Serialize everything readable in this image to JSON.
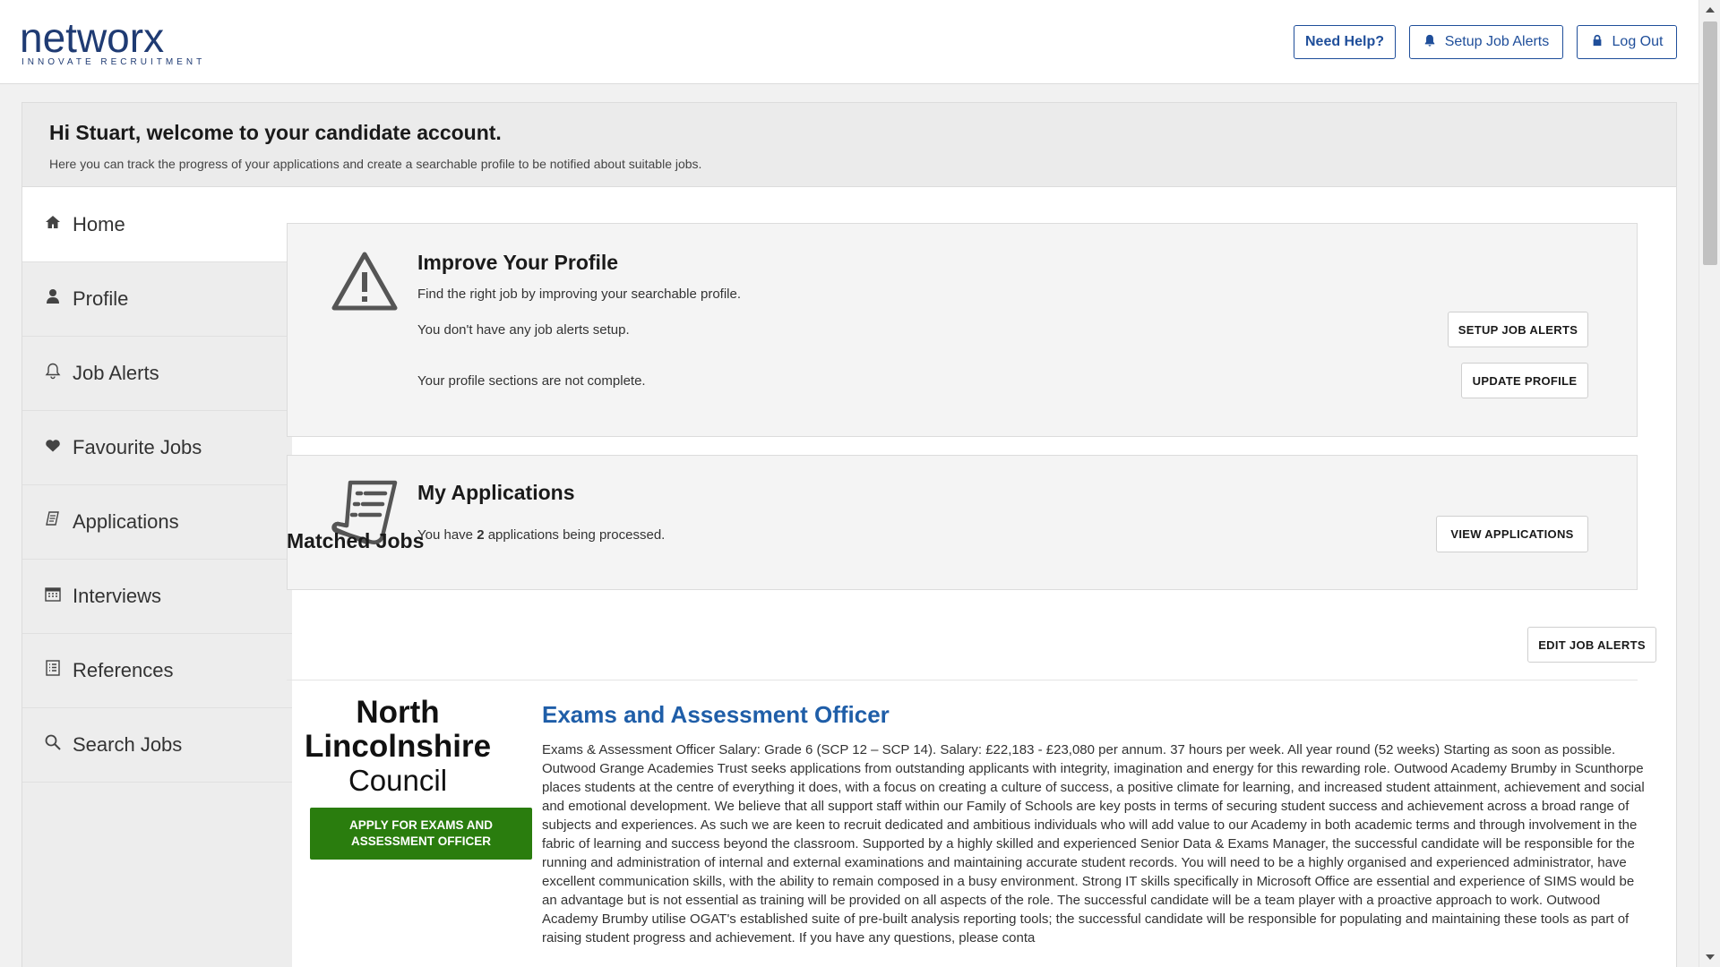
{
  "header": {
    "logo_word": "networx",
    "logo_tagline": "INNOVATE RECRUITMENT",
    "need_help": "Need Help?",
    "setup_alerts": "Setup Job Alerts",
    "log_out": "Log Out"
  },
  "welcome": {
    "title": "Hi Stuart, welcome to your candidate account.",
    "subtitle": "Here you can track the progress of your applications and create a searchable profile to be notified about suitable jobs."
  },
  "sidebar": {
    "items": [
      {
        "label": "Home",
        "icon": "home-icon",
        "active": true
      },
      {
        "label": "Profile",
        "icon": "user-icon"
      },
      {
        "label": "Job Alerts",
        "icon": "bell-icon"
      },
      {
        "label": "Favourite Jobs",
        "icon": "heart-icon"
      },
      {
        "label": "Applications",
        "icon": "document-icon"
      },
      {
        "label": "Interviews",
        "icon": "calendar-icon"
      },
      {
        "label": "References",
        "icon": "list-icon"
      },
      {
        "label": "Search Jobs",
        "icon": "search-icon"
      }
    ]
  },
  "profile_card": {
    "title": "Improve Your Profile",
    "intro": "Find the right job by improving your searchable profile.",
    "alerts_text": "You don't have any job alerts setup.",
    "sections_text": "Your profile sections are not complete.",
    "setup_btn": "SETUP JOB ALERTS",
    "update_btn": "UPDATE PROFILE"
  },
  "applications_card": {
    "title": "My Applications",
    "text_before": "You have ",
    "count": "2",
    "text_after": " applications being processed.",
    "view_btn": "VIEW APPLICATIONS"
  },
  "matched": {
    "title": "Matched Jobs",
    "edit_btn": "EDIT JOB ALERTS",
    "job": {
      "employer_line1": "North",
      "employer_line2": "Lincolnshire",
      "employer_line3": "Council",
      "apply_btn": "APPLY FOR EXAMS AND ASSESSMENT OFFICER",
      "title": "Exams and Assessment Officer",
      "description": "Exams & Assessment Officer Salary: Grade 6 (SCP 12 – SCP 14). Salary: £22,183 - £23,080 per annum. 37 hours per week. All year round (52 weeks) Starting as soon as possible. Outwood Grange Academies Trust seeks applications from outstanding applicants with integrity, imagination and energy for this rewarding role. Outwood Academy Brumby in Scunthorpe places students at the centre of everything it does, with a focus on creating a culture of success, a positive climate for learning, and increased student attainment, achievement and social and emotional development. We believe that all support staff within our Family of Schools are key posts in terms of securing student success and achievement across a broad range of subjects and experiences. As such we are keen to recruit dedicated and ambitious individuals who will add value to our Academy in both academic terms and through involvement in the fabric of learning and success beyond the classroom. Supported by a highly skilled and experienced Senior Data & Exams Manager, the successful candidate will be responsible for the running and administration of internal and external examinations and maintaining accurate student records. You will need to be a highly organised and experienced administrator, have excellent communication skills, with the ability to remain composed in a busy environment. Strong IT skills specifically in Microsoft Office are essential and experience of SIMS would be an advantage but is not essential as training will be provided on all aspects of the role. The successful candidate will be a team player with a proactive approach to work. Outwood Academy Brumby utilise OGAT's established suite of pre-built analysis reporting tools; the successful candidate will be responsible for populating and maintaining these tools as part of raising student progress and achievement. If you have any questions, please conta"
    }
  },
  "colors": {
    "brand": "#1f3b73",
    "link": "#1f5ea8",
    "apply": "#2a7d0e"
  }
}
